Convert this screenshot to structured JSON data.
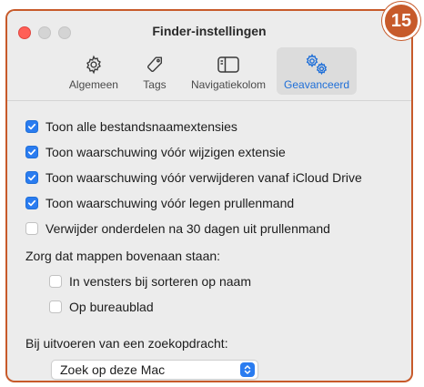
{
  "window": {
    "title": "Finder-instellingen"
  },
  "badge": "15",
  "tabs": [
    {
      "label": "Algemeen",
      "icon": "gear-icon",
      "active": false
    },
    {
      "label": "Tags",
      "icon": "tag-icon",
      "active": false
    },
    {
      "label": "Navigatiekolom",
      "icon": "sidebar-icon",
      "active": false
    },
    {
      "label": "Geavanceerd",
      "icon": "gears-icon",
      "active": true
    }
  ],
  "options": {
    "show_extensions": {
      "label": "Toon alle bestandsnaamextensies",
      "checked": true
    },
    "warn_change_extension": {
      "label": "Toon waarschuwing vóór wijzigen extensie",
      "checked": true
    },
    "warn_icloud_remove": {
      "label": "Toon waarschuwing vóór verwijderen vanaf iCloud Drive",
      "checked": true
    },
    "warn_empty_trash": {
      "label": "Toon waarschuwing vóór legen prullenmand",
      "checked": true
    },
    "remove_after_30": {
      "label": "Verwijder onderdelen na 30 dagen uit prullenmand",
      "checked": false
    }
  },
  "folders_on_top": {
    "label": "Zorg dat mappen bovenaan staan:",
    "in_windows": {
      "label": "In vensters bij sorteren op naam",
      "checked": false
    },
    "on_desktop": {
      "label": "Op bureaublad",
      "checked": false
    }
  },
  "search": {
    "label": "Bij uitvoeren van een zoekopdracht:",
    "selected": "Zoek op deze Mac"
  },
  "colors": {
    "accent": "#2a7cf0",
    "frame": "#c75a2a",
    "close": "#ff5f57"
  }
}
